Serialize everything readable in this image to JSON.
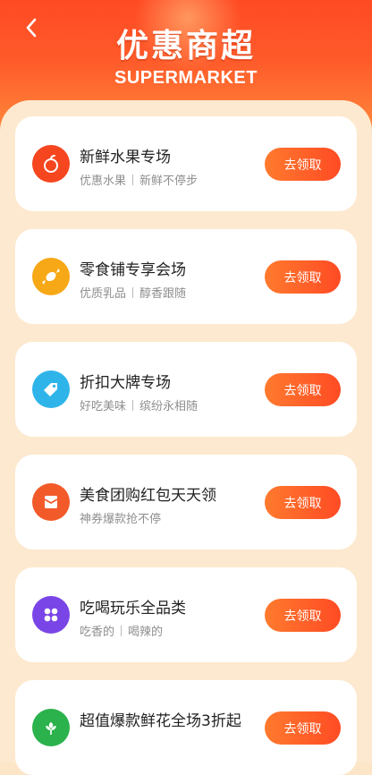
{
  "header": {
    "title": "优惠商超",
    "subtitle": "SUPERMARKET"
  },
  "cards": [
    {
      "title": "新鲜水果专场",
      "tags": [
        "优惠水果",
        "新鲜不停步"
      ],
      "button": "去领取",
      "icon": "fruit-icon",
      "color": "#f5461f"
    },
    {
      "title": "零食铺专享会场",
      "tags": [
        "优质乳品",
        "醇香跟随"
      ],
      "button": "去领取",
      "icon": "candy-icon",
      "color": "#f7a816"
    },
    {
      "title": "折扣大牌专场",
      "tags": [
        "好吃美味",
        "缤纷永相随"
      ],
      "button": "去领取",
      "icon": "tag-icon",
      "color": "#2fb4ea"
    },
    {
      "title": "美食团购红包天天领",
      "tags": [
        "神券爆款抢不停"
      ],
      "button": "去领取",
      "icon": "envelope-icon",
      "color": "#f25a2a"
    },
    {
      "title": "吃喝玩乐全品类",
      "tags": [
        "吃香的",
        "喝辣的"
      ],
      "button": "去领取",
      "icon": "grid-icon",
      "color": "#7a45e6"
    },
    {
      "title": "超值爆款鲜花全场3折起",
      "tags": [],
      "button": "去领取",
      "icon": "flower-icon",
      "color": "#2bb24c"
    }
  ]
}
